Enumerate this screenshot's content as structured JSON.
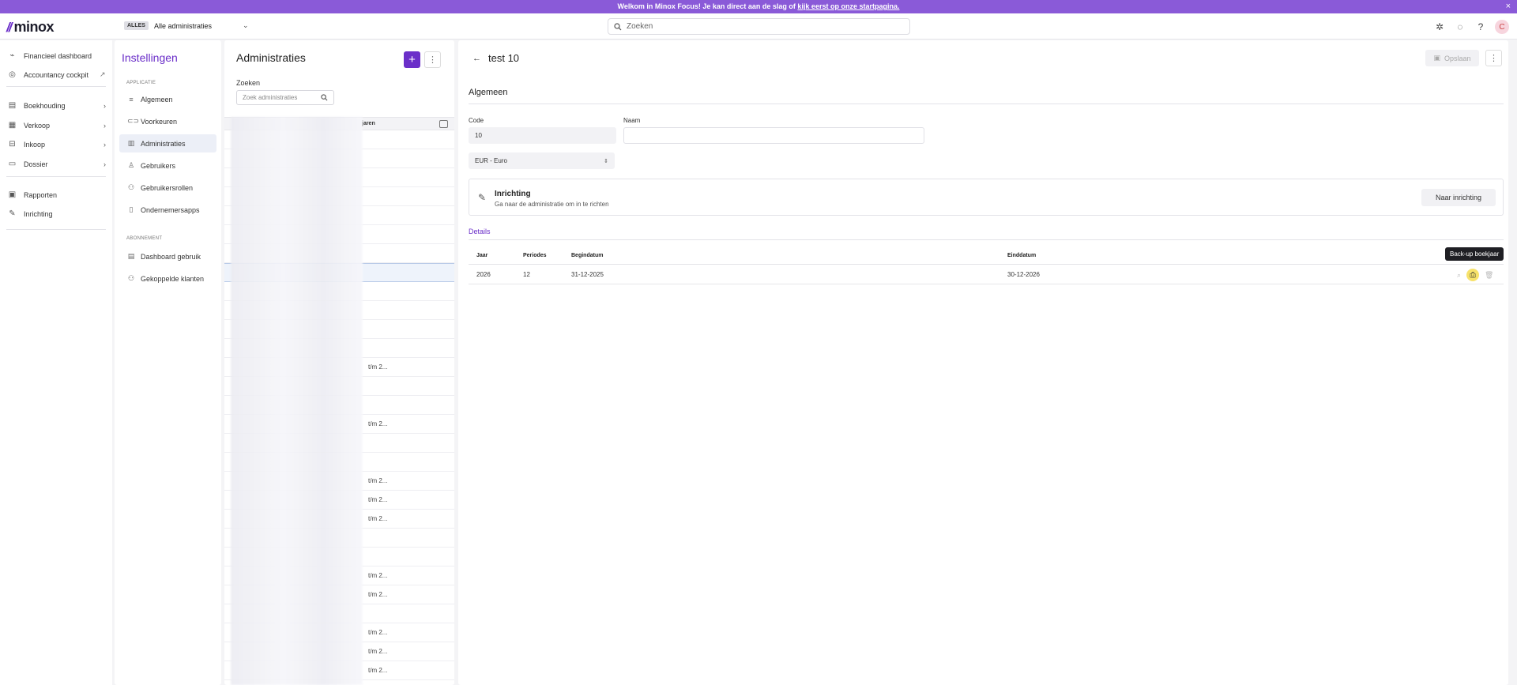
{
  "banner": {
    "text": "Welkom in Minox Focus! Je kan direct aan de slag of ",
    "link": "kijk eerst op onze startpagina.",
    "close": "×"
  },
  "topbar": {
    "logo_text": "minox",
    "scope_chip": "ALLES",
    "scope_label": "Alle administraties",
    "search_placeholder": "Zoeken",
    "avatar_letter": "C"
  },
  "leftnav": {
    "items": [
      {
        "label": "Financieel dashboard"
      },
      {
        "label": "Accountancy cockpit"
      },
      {
        "label": "Boekhouding"
      },
      {
        "label": "Verkoop"
      },
      {
        "label": "Inkoop"
      },
      {
        "label": "Dossier"
      },
      {
        "label": "Rapporten"
      },
      {
        "label": "Inrichting"
      }
    ]
  },
  "settings": {
    "title": "Instellingen",
    "section_app": "APPLICATIE",
    "items": [
      {
        "label": "Algemeen"
      },
      {
        "label": "Voorkeuren"
      },
      {
        "label": "Administraties"
      },
      {
        "label": "Gebruikers"
      },
      {
        "label": "Gebruikersrollen"
      },
      {
        "label": "Ondernemersapps"
      }
    ],
    "section_sub": "ABONNEMENT",
    "sub_items": [
      {
        "label": "Dashboard gebruik"
      },
      {
        "label": "Gekoppelde klanten"
      }
    ]
  },
  "list": {
    "title": "Administraties",
    "add_label": "+",
    "more_label": "⋮",
    "search_label": "Zoeken",
    "search_placeholder": "Zoek administraties",
    "column_label": "jaren",
    "rows": [
      "",
      "",
      "",
      "",
      "",
      "",
      "",
      "",
      "",
      "",
      "",
      "",
      "t/m 2...",
      "",
      "",
      "t/m 2...",
      "",
      "",
      "t/m 2...",
      "t/m 2...",
      "t/m 2...",
      "",
      "",
      "t/m 2...",
      "t/m 2...",
      "",
      "t/m 2...",
      "t/m 2...",
      "t/m 2...",
      ""
    ]
  },
  "detail": {
    "title": "test 10",
    "save_label": "Opslaan",
    "more_label": "⋮",
    "section_title": "Algemeen",
    "code_label": "Code",
    "code_value": "10",
    "name_label": "Naam",
    "name_value": "",
    "currency_value": "EUR - Euro",
    "setup_title": "Inrichting",
    "setup_desc": "Ga naar de administratie om in te richten",
    "setup_button": "Naar inrichting",
    "details_label": "Details",
    "table_headers": {
      "jaar": "Jaar",
      "periodes": "Periodes",
      "begindatum": "Begindatum",
      "einddatum": "Einddatum"
    },
    "year_rows": [
      {
        "jaar": "2026",
        "periodes": "12",
        "begindatum": "31-12-2025",
        "einddatum": "30-12-2026"
      }
    ],
    "tooltip": "Back-up boekjaar"
  },
  "colors": {
    "brand": "#6b2fc9",
    "banner": "#8a5ad8"
  }
}
